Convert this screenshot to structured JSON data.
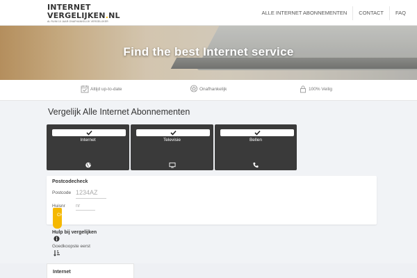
{
  "header": {
    "logo_line1": "INTERNET",
    "logo_line2": "VERGELIJKEN",
    "logo_dot": ".",
    "logo_tld": "NL",
    "logo_tagline": "AL RUIM 10 JAAR ONAFHANKELIJK VERGELIJKER",
    "nav": [
      "ALLE INTERNET ABONNEMENTEN",
      "CONTACT",
      "FAQ"
    ]
  },
  "hero": {
    "title": "Find the best Internet service"
  },
  "features": [
    {
      "label": "Altijd up-to-date",
      "icon": "calendar-check-icon"
    },
    {
      "label": "Onafhankelijk",
      "icon": "award-star-icon"
    },
    {
      "label": "100% Veilig",
      "icon": "lock-icon"
    }
  ],
  "section_title": "Vergelijk Alle Internet Abonnementen",
  "services": [
    {
      "label": "Internet",
      "icon": "globe-icon",
      "checked": true
    },
    {
      "label": "Televisie",
      "icon": "tv-icon",
      "checked": true
    },
    {
      "label": "Bellen",
      "icon": "phone-icon",
      "checked": true
    }
  ],
  "postcode": {
    "title": "Postcodecheck",
    "postcode_label": "Postcode",
    "postcode_placeholder": "1234AZ",
    "huisnr_label": "Huisnr",
    "huisnr_placeholder": "nr",
    "check_label": "CHECK"
  },
  "help": {
    "title": "Hulp bij vergelijken",
    "sort_label": "Goedkoopste eerst"
  },
  "results": {
    "title": "Internet"
  },
  "colors": {
    "accent": "#f5b800",
    "card_bg": "#3a3a3a",
    "page_bg": "#f1f3f6"
  }
}
